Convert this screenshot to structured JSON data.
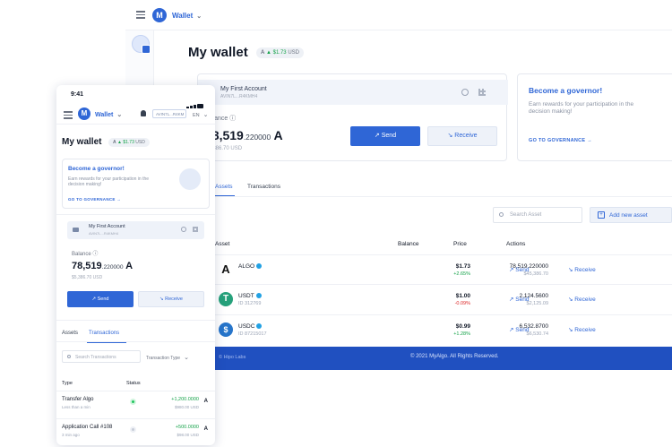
{
  "desktop": {
    "header": {
      "network_label": "Wallet",
      "logo_letter": "M"
    },
    "title": "My wallet",
    "price_chip": {
      "symbol": "A",
      "change": "▲ $1.73",
      "usd": "USD"
    },
    "account": {
      "name": "My First Account",
      "address": "AVIN7L...R4KMH4",
      "balance_label": "Balance",
      "balance_main": "78,519",
      "balance_decimals": ".220000",
      "balance_unit": "A",
      "balance_usd": "$5,386.70 USD",
      "send_label": "Send",
      "receive_label": "Receive"
    },
    "governor": {
      "title": "Become a governor!",
      "description": "Earn rewards for your participation in the decision making!",
      "link": "GO TO GOVERNANCE →"
    },
    "tabs": [
      "Assets",
      "Transactions"
    ],
    "search_placeholder": "Search Asset",
    "add_asset_label": "Add new asset",
    "table": {
      "headers": {
        "asset": "Asset",
        "balance": "Balance",
        "price": "Price",
        "actions": "Actions"
      },
      "rows": [
        {
          "symbol": "ALGO",
          "id": "",
          "balance": "78,519.220000",
          "balance_usd": "$45,386.70",
          "price": "$1.73",
          "change": "+2.65%",
          "change_type": "pos",
          "icon_color": "#ffffff"
        },
        {
          "symbol": "USDT",
          "id": "ID 312769",
          "balance": "2,124.5600",
          "balance_usd": "$2,125.09",
          "price": "$1.00",
          "change": "-0.09%",
          "change_type": "neg",
          "icon_color": "#26a17b"
        },
        {
          "symbol": "USDC",
          "id": "ID 87215017",
          "balance": "6,532.8700",
          "balance_usd": "$6,530.74",
          "price": "$0.99",
          "change": "+1.28%",
          "change_type": "pos",
          "icon_color": "#2775ca"
        }
      ],
      "send_label": "Send",
      "receive_label": "Receive"
    },
    "footer": {
      "left": "© Hipo Labs",
      "center": "© 2021 MyAlgo. All Rights Reserved."
    }
  },
  "mobile": {
    "time": "9:41",
    "network_label": "Wallet",
    "address_chip": "AVIN7L...R4KM",
    "lang": "EN",
    "title": "My wallet",
    "price_chip": {
      "symbol": "A",
      "change": "▲ $1.73",
      "usd": "USD"
    },
    "governor": {
      "title": "Become a governor!",
      "description": "Earn rewards for your participation in the decision making!",
      "link": "GO TO GOVERNANCE →"
    },
    "account": {
      "name": "My First Account",
      "address": "AVIN7L...R4KMH4",
      "balance_label": "Balance",
      "balance_main": "78,519",
      "balance_decimals": ".220000",
      "balance_unit": "A",
      "balance_usd": "$5,386.70 USD",
      "send_label": "Send",
      "receive_label": "Receive"
    },
    "tabs": [
      "Assets",
      "Transactions"
    ],
    "search_placeholder": "Search Transactions",
    "filter_label": "Transaction Type",
    "list_headers": {
      "type": "Type",
      "status": "Status"
    },
    "transactions": [
      {
        "type": "Transfer Algo",
        "time": "Less than a min",
        "amount": "+1,200.0000",
        "usd": "$980.00 USD",
        "status": "done"
      },
      {
        "type": "Application Call #108",
        "time": "3 min ago",
        "amount": "+500.0000",
        "usd": "$98.00 USD",
        "status": "pending"
      }
    ]
  },
  "colors": {
    "accent": "#2f66d6",
    "footer": "#2050c0",
    "positive": "#16a34a",
    "negative": "#dc2626"
  }
}
